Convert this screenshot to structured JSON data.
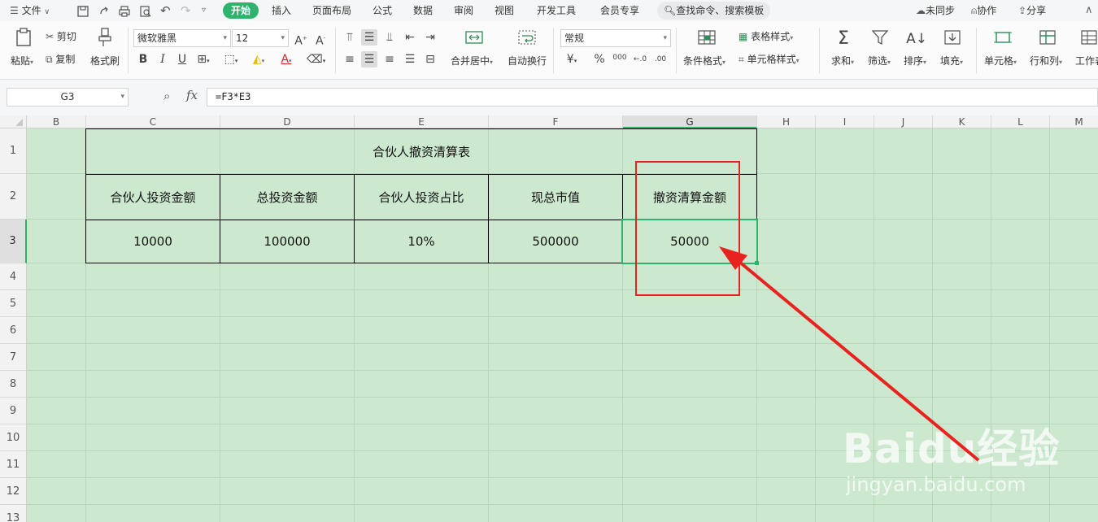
{
  "menubar": {
    "file_label": "文件",
    "tabs": [
      "开始",
      "插入",
      "页面布局",
      "公式",
      "数据",
      "审阅",
      "视图",
      "开发工具",
      "会员专享"
    ],
    "search_placeholder": "查找命令、搜索模板",
    "sync_label": "未同步",
    "collab_label": "协作",
    "share_label": "分享"
  },
  "ribbon": {
    "paste": "粘贴",
    "cut": "剪切",
    "copy": "复制",
    "format_painter": "格式刷",
    "font_name": "微软雅黑",
    "font_size": "12",
    "bold": "B",
    "italic": "I",
    "underline": "U",
    "merge_center": "合并居中",
    "wrap_text": "自动换行",
    "number_format": "常规",
    "currency": "¥",
    "percent": "%",
    "thousands": "000",
    "cond_format": "条件格式",
    "table_style": "表格样式",
    "cell_style": "单元格样式",
    "sum": "求和",
    "filter": "筛选",
    "sort": "排序",
    "fill": "填充",
    "cell": "单元格",
    "rows_cols": "行和列",
    "worksheet": "工作表"
  },
  "formula_bar": {
    "name_box": "G3",
    "fx": "fx",
    "formula": "=F3*E3"
  },
  "columns": [
    "B",
    "C",
    "D",
    "E",
    "F",
    "G",
    "H",
    "I",
    "J",
    "K",
    "L",
    "M"
  ],
  "rows": [
    "1",
    "2",
    "3",
    "4",
    "5",
    "6",
    "7",
    "8",
    "9",
    "10",
    "11",
    "12",
    "13"
  ],
  "table": {
    "title": "合伙人撤资清算表",
    "headers": [
      "合伙人投资金额",
      "总投资金额",
      "合伙人投资占比",
      "现总市值",
      "撤资清算金额"
    ],
    "values": [
      "10000",
      "100000",
      "10%",
      "500000",
      "50000"
    ]
  },
  "watermark": {
    "brand": "Baidu经验",
    "url": "jingyan.baidu.com"
  },
  "colors": {
    "accent": "#2fb36c",
    "grid_bg": "#cce8cf",
    "highlight": "#e8231f"
  }
}
